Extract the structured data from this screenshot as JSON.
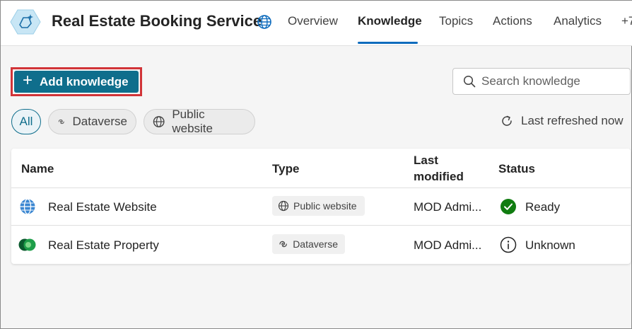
{
  "header": {
    "agent_name": "Real Estate Booking Service",
    "tabs": [
      {
        "label": "Overview",
        "active": false
      },
      {
        "label": "Knowledge",
        "active": true
      },
      {
        "label": "Topics",
        "active": false
      },
      {
        "label": "Actions",
        "active": false
      },
      {
        "label": "Analytics",
        "active": false
      },
      {
        "label": "+7",
        "active": false
      }
    ]
  },
  "toolbar": {
    "add_label": "Add knowledge",
    "search_placeholder": "Search knowledge"
  },
  "filters": {
    "chips": [
      {
        "label": "All",
        "selected": true
      },
      {
        "label": "Dataverse",
        "icon": "dataverse-icon"
      },
      {
        "label": "Public website",
        "icon": "globe-icon"
      }
    ],
    "refresh_label": "Last refreshed now"
  },
  "table": {
    "columns": [
      "Name",
      "Type",
      "Last modified",
      "Status"
    ],
    "rows": [
      {
        "name": "Real Estate Website",
        "icon": "globe-icon",
        "type": "Public website",
        "modified": "MOD Admi...",
        "status": "Ready",
        "status_icon": "check-circle-icon"
      },
      {
        "name": "Real Estate Property",
        "icon": "dataverse-logo-icon",
        "type": "Dataverse",
        "modified": "MOD Admi...",
        "status": "Unknown",
        "status_icon": "info-circle-icon"
      }
    ]
  },
  "colors": {
    "accent": "#0f6e8c",
    "highlight_outline": "#d13438",
    "tab_underline": "#0f6cbd",
    "ready_green": "#107c10"
  }
}
